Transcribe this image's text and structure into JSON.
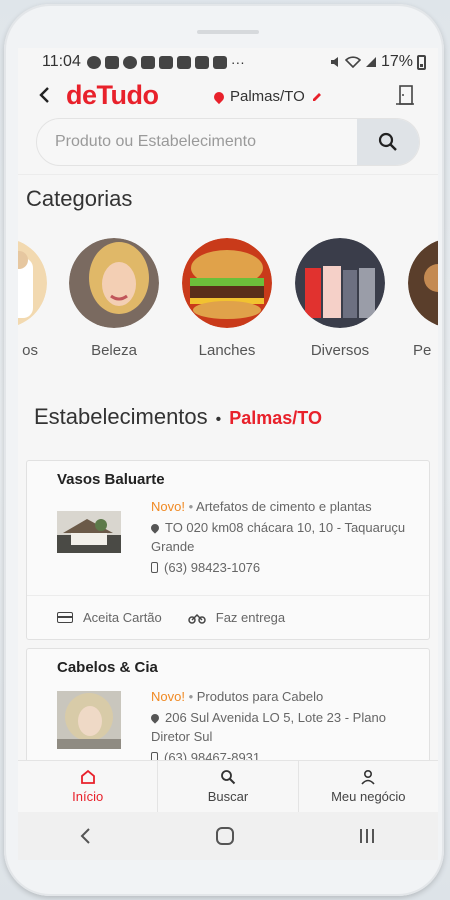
{
  "status_bar": {
    "time": "11:04",
    "battery": "17%"
  },
  "header": {
    "logo": "deTudo",
    "location": "Palmas/TO"
  },
  "search": {
    "placeholder": "Produto ou Estabelecimento"
  },
  "categories": {
    "title": "Categorias",
    "items": [
      {
        "label": "os"
      },
      {
        "label": "Beleza"
      },
      {
        "label": "Lanches"
      },
      {
        "label": "Diversos"
      },
      {
        "label": "Pe"
      }
    ]
  },
  "establishments": {
    "title": "Estabelecimentos",
    "city": "Palmas/TO",
    "cards": [
      {
        "name": "Vasos Baluarte",
        "badge": "Novo!",
        "category": "Artefatos de cimento e plantas",
        "address": "TO 020 km08 chácara 10, 10 - Taquaruçu Grande",
        "phone": "(63) 98423-1076",
        "feature_card": "Aceita Cartão",
        "feature_delivery": "Faz entrega"
      },
      {
        "name": "Cabelos & Cia",
        "badge": "Novo!",
        "category": "Produtos para Cabelo",
        "address": "206 Sul Avenida LO 5, Lote 23 - Plano Diretor Sul",
        "phone": "(63) 98467-8931"
      }
    ]
  },
  "bottom_nav": {
    "home": "Início",
    "search": "Buscar",
    "business": "Meu negócio"
  },
  "colors": {
    "brand": "#e8212b",
    "new_badge": "#f08a24"
  }
}
